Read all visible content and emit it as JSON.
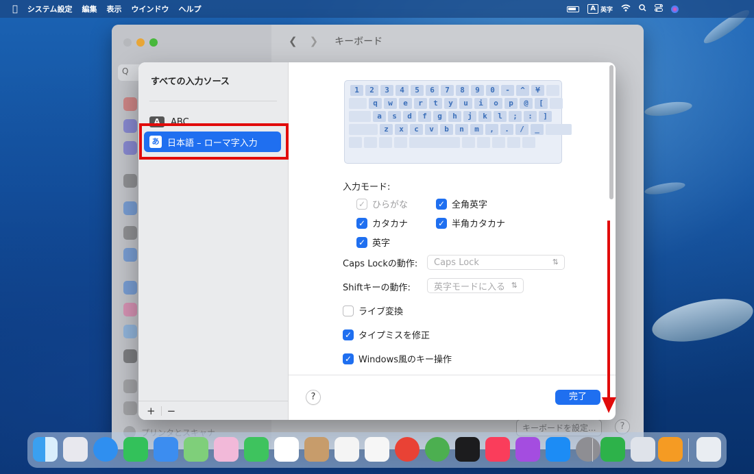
{
  "menubar": {
    "app_name": "システム設定",
    "items": [
      "編集",
      "表示",
      "ウインドウ",
      "ヘルプ"
    ],
    "input_indicator": "A",
    "input_label": "英字"
  },
  "settings_window": {
    "title": "キーボード",
    "search_placeholder": "Q",
    "printer_label": "プリンタとスキャナ",
    "keyboard_settings_button": "キーボードを設定...",
    "help": "?"
  },
  "sheet": {
    "sidebar_title": "すべての入力ソース",
    "sources": [
      {
        "badge": "A",
        "label": "ABC"
      },
      {
        "badge": "あ",
        "label": "日本語 – ローマ字入力"
      }
    ],
    "add_label": "+",
    "remove_label": "−",
    "keyboard_rows": [
      [
        "1",
        "2",
        "3",
        "4",
        "5",
        "6",
        "7",
        "8",
        "9",
        "0",
        "-",
        "^",
        "¥"
      ],
      [
        "q",
        "w",
        "e",
        "r",
        "t",
        "y",
        "u",
        "i",
        "o",
        "p",
        "@",
        "["
      ],
      [
        "a",
        "s",
        "d",
        "f",
        "g",
        "h",
        "j",
        "k",
        "l",
        ";",
        ":",
        "]"
      ],
      [
        "z",
        "x",
        "c",
        "v",
        "b",
        "n",
        "m",
        ",",
        ".",
        "/",
        "_"
      ]
    ],
    "input_mode_label": "入力モード:",
    "input_modes": [
      {
        "label": "ひらがな",
        "checked": true,
        "disabled": true
      },
      {
        "label": "全角英字",
        "checked": true,
        "disabled": false
      },
      {
        "label": "カタカナ",
        "checked": true,
        "disabled": false
      },
      {
        "label": "半角カタカナ",
        "checked": true,
        "disabled": false
      },
      {
        "label": "英字",
        "checked": true,
        "disabled": false
      }
    ],
    "caps_lock_label": "Caps Lockの動作:",
    "caps_lock_value": "Caps Lock",
    "shift_label": "Shiftキーの動作:",
    "shift_value": "英字モードに入る",
    "options": [
      {
        "label": "ライブ変換",
        "checked": false
      },
      {
        "label": "タイプミスを修正",
        "checked": true
      },
      {
        "label": "Windows風のキー操作",
        "checked": true
      }
    ],
    "help": "?",
    "done": "完了"
  },
  "colors": {
    "accent": "#1f6ff0",
    "highlight": "#e10b0b"
  }
}
